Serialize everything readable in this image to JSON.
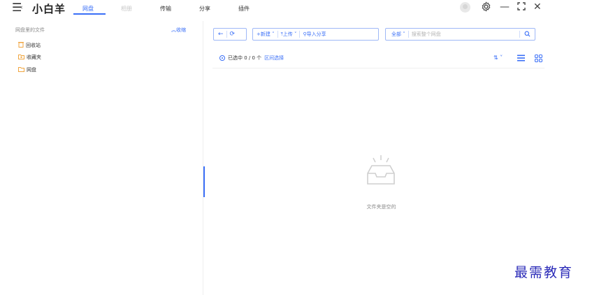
{
  "app": {
    "menu_icon": "menu-icon",
    "title": "小白羊"
  },
  "nav": {
    "tabs": [
      {
        "label": "网盘",
        "state": "active"
      },
      {
        "label": "相册",
        "state": "disabled"
      },
      {
        "label": "传输",
        "state": "normal"
      },
      {
        "label": "分享",
        "state": "normal"
      },
      {
        "label": "插件",
        "state": "normal"
      }
    ],
    "accent_color": "#3a6ff7"
  },
  "window_controls": {
    "avatar_icon": "user-avatar-icon",
    "settings_icon": "gear-icon",
    "minimize_label": "—",
    "maximize_label": "⛶",
    "close_label": "✕"
  },
  "sidebar": {
    "title": "网盘里的文件",
    "collapse_label": "收缩",
    "items": [
      {
        "label": "回收站",
        "icon": "trash-icon"
      },
      {
        "label": "收藏夹",
        "icon": "star-folder-icon"
      },
      {
        "label": "网盘",
        "icon": "folder-icon"
      }
    ]
  },
  "toolbar": {
    "back_icon": "←",
    "refresh_icon": "⟳",
    "new_label": "新建",
    "upload_label": "上传",
    "import_share_label": "导入分享",
    "filter_label": "全部",
    "search_placeholder": "搜索整个网盘",
    "search_icon": "search-icon"
  },
  "selection": {
    "text": "已选中 0 / 0 个",
    "range_select_label": "区间选择",
    "sort_icon": "sort-icon",
    "list_view_icon": "list-view-icon",
    "grid_view_icon": "grid-view-icon"
  },
  "empty_state": {
    "icon": "empty-inbox-icon",
    "text": "文件夹是空的"
  },
  "watermark": {
    "text": "最需教育"
  }
}
